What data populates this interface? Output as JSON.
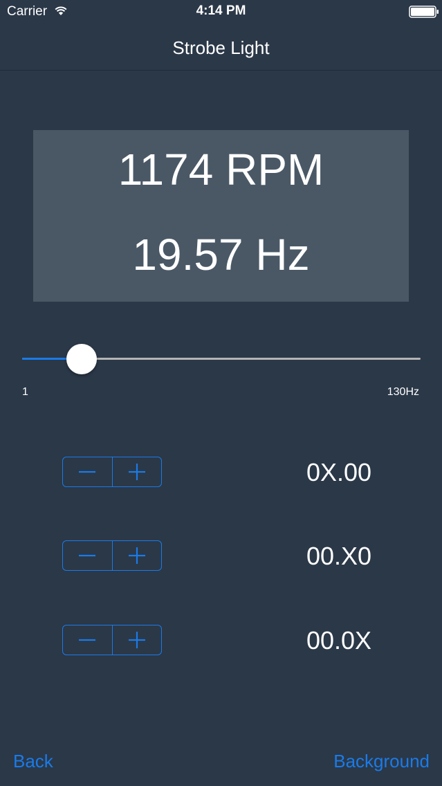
{
  "status_bar": {
    "carrier": "Carrier",
    "time": "4:14 PM"
  },
  "nav": {
    "title": "Strobe Light"
  },
  "readout": {
    "rpm": "1174 RPM",
    "hz": "19.57 Hz"
  },
  "slider": {
    "min_label": "1",
    "max_label": "130Hz",
    "value_fraction": 0.15
  },
  "steppers": [
    {
      "label": "0X.00"
    },
    {
      "label": "00.X0"
    },
    {
      "label": "00.0X"
    }
  ],
  "bottom": {
    "back": "Back",
    "background": "Background"
  },
  "colors": {
    "accent": "#1a7be8",
    "background": "#2b3848",
    "panel": "#4a5866"
  },
  "icons": {
    "minus": "minus-icon",
    "plus": "plus-icon",
    "wifi": "wifi-icon",
    "battery": "battery-icon"
  }
}
